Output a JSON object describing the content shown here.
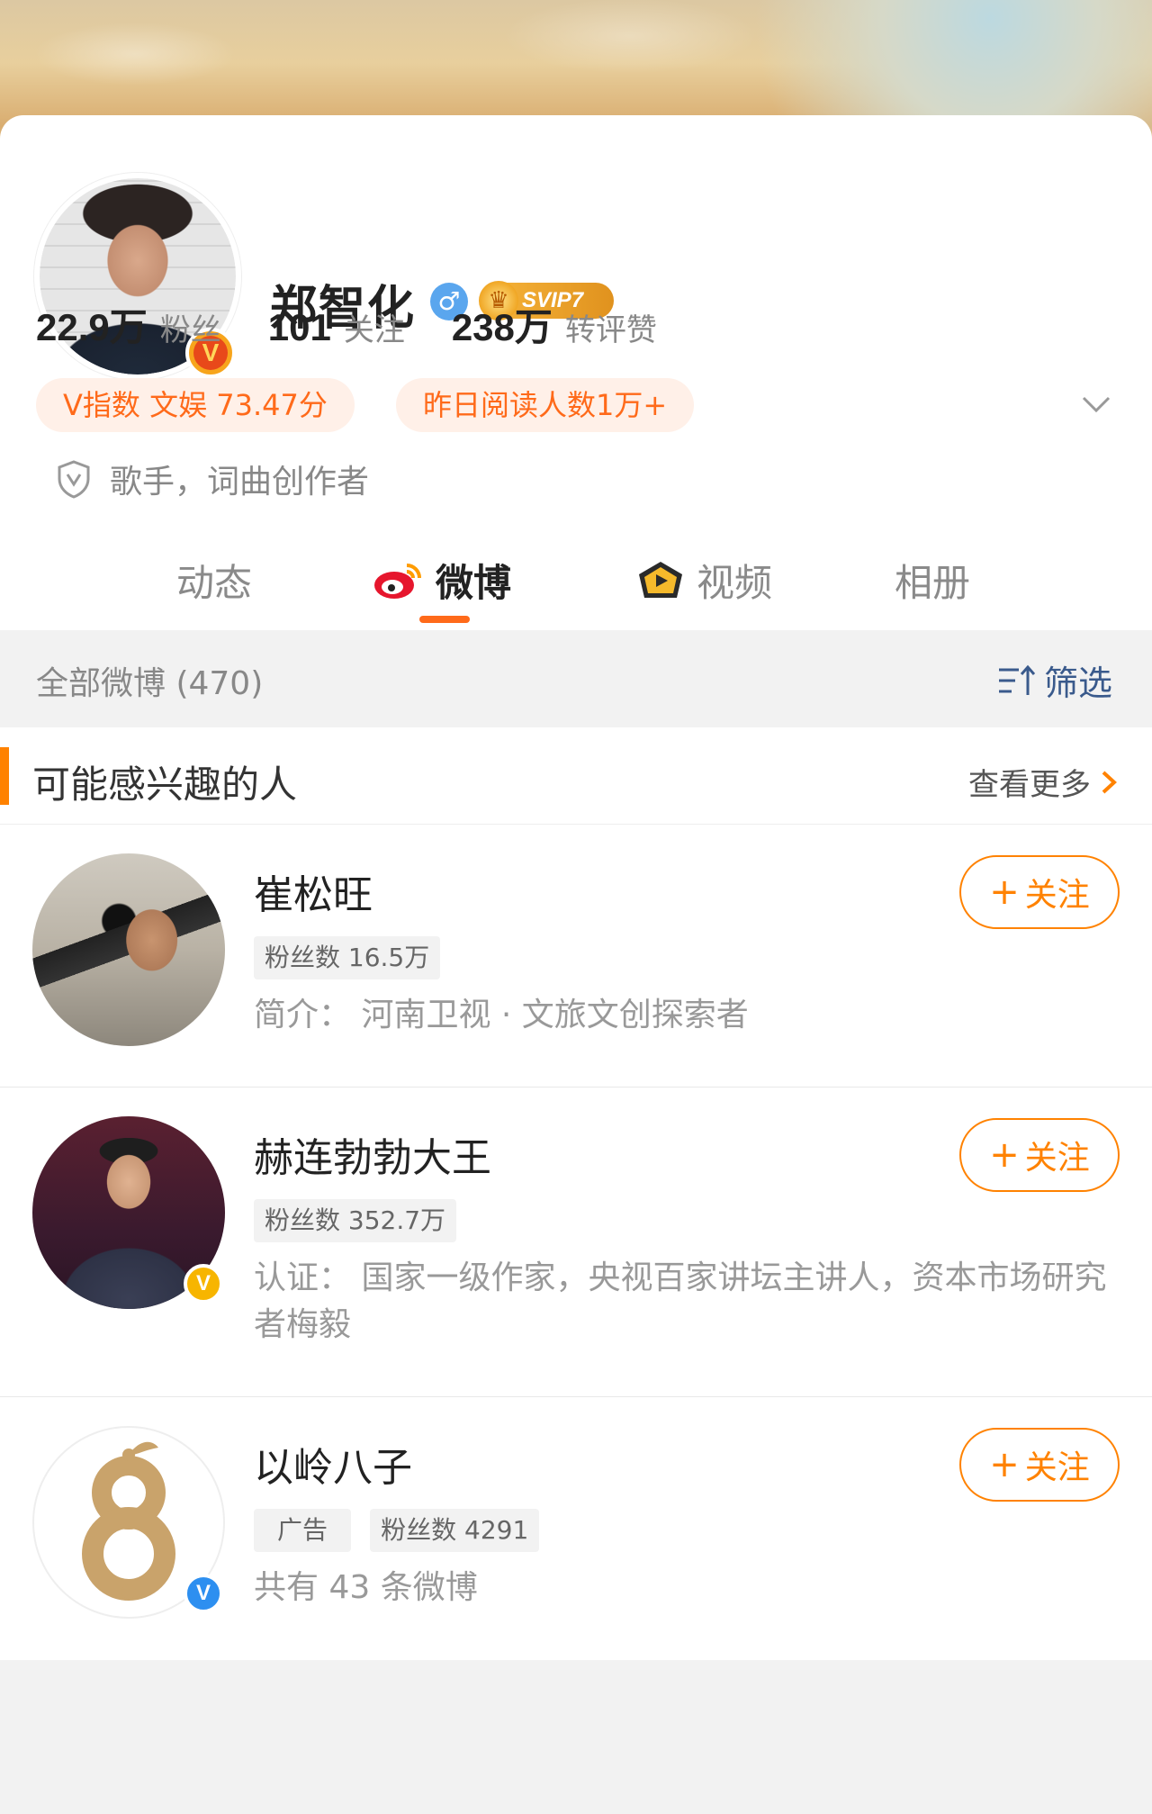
{
  "profile": {
    "name": "郑智化",
    "gender_icon": "♂",
    "verified_badge": "V",
    "svip_label": "SVIP7",
    "stats": [
      {
        "num": "22.9万",
        "label": "粉丝"
      },
      {
        "num": "101",
        "label": "关注"
      },
      {
        "num": "238万",
        "label": "转评赞"
      }
    ],
    "pills": {
      "vindex": "V指数 文娱 73.47分",
      "reads": "昨日阅读人数1万+"
    },
    "description": "歌手，词曲创作者"
  },
  "tabs": [
    {
      "label": "动态",
      "icon": ""
    },
    {
      "label": "微博",
      "icon": "weibo-logo-icon"
    },
    {
      "label": "视频",
      "icon": "video-icon"
    },
    {
      "label": "相册",
      "icon": ""
    }
  ],
  "active_tab": "微博",
  "filter_bar": {
    "count_text": "全部微博 (470)",
    "filter_label": "筛选"
  },
  "recommend": {
    "title": "可能感兴趣的人",
    "more": "查看更多",
    "items": [
      {
        "name": "崔松旺",
        "tags": [
          "粉丝数 16.5万"
        ],
        "desc": "简介：  河南卫视 · 文旅文创探索者",
        "follow": "关注"
      },
      {
        "name": "赫连勃勃大王",
        "tags": [
          "粉丝数 352.7万"
        ],
        "desc": "认证：  国家一级作家，央视百家讲坛主讲人，资本市场研究者梅毅",
        "badge": "V",
        "follow": "关注"
      },
      {
        "name": "以岭八子",
        "tags": [
          "广告",
          "粉丝数 4291"
        ],
        "desc": "共有 43 条微博",
        "badge": "V",
        "follow": "关注"
      }
    ]
  },
  "colors": {
    "accent": "#ff8200",
    "tab_underline": "#ff6a1a",
    "link_blue": "#3a5a8c"
  }
}
